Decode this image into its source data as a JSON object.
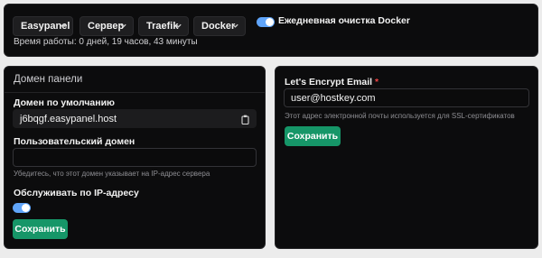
{
  "topbar": {
    "menus": [
      {
        "label": "Easypanel"
      },
      {
        "label": "Сервер"
      },
      {
        "label": "Traefik"
      },
      {
        "label": "Docker"
      }
    ],
    "daily_cleanup_label": "Ежедневная очистка Docker",
    "daily_cleanup_enabled": true,
    "uptime_text": "Время работы: 0 дней, 19 часов, 43 минуты"
  },
  "panel_domain": {
    "title": "Домен панели",
    "default_domain_label": "Домен по умолчанию",
    "default_domain_value": "j6bqgf.easypanel.host",
    "custom_domain_label": "Пользовательский домен",
    "custom_domain_value": "",
    "custom_domain_hint": "Убедитесь, что этот домен указывает на IP-адрес сервера",
    "serve_by_ip_label": "Обслуживать по IP-адресу",
    "serve_by_ip_enabled": true,
    "save_label": "Сохранить"
  },
  "letsencrypt": {
    "email_label": "Let's Encrypt Email",
    "required_mark": "*",
    "email_value": "user@hostkey.com",
    "email_hint": "Этот адрес электронной почты используется для SSL-сертификатов",
    "save_label": "Сохранить"
  },
  "icons": {
    "chevron": "chevron-down-icon",
    "copy": "clipboard-icon"
  },
  "colors": {
    "accent_toggle": "#60a5fa",
    "save_button": "#169668",
    "required": "#ef4444"
  }
}
